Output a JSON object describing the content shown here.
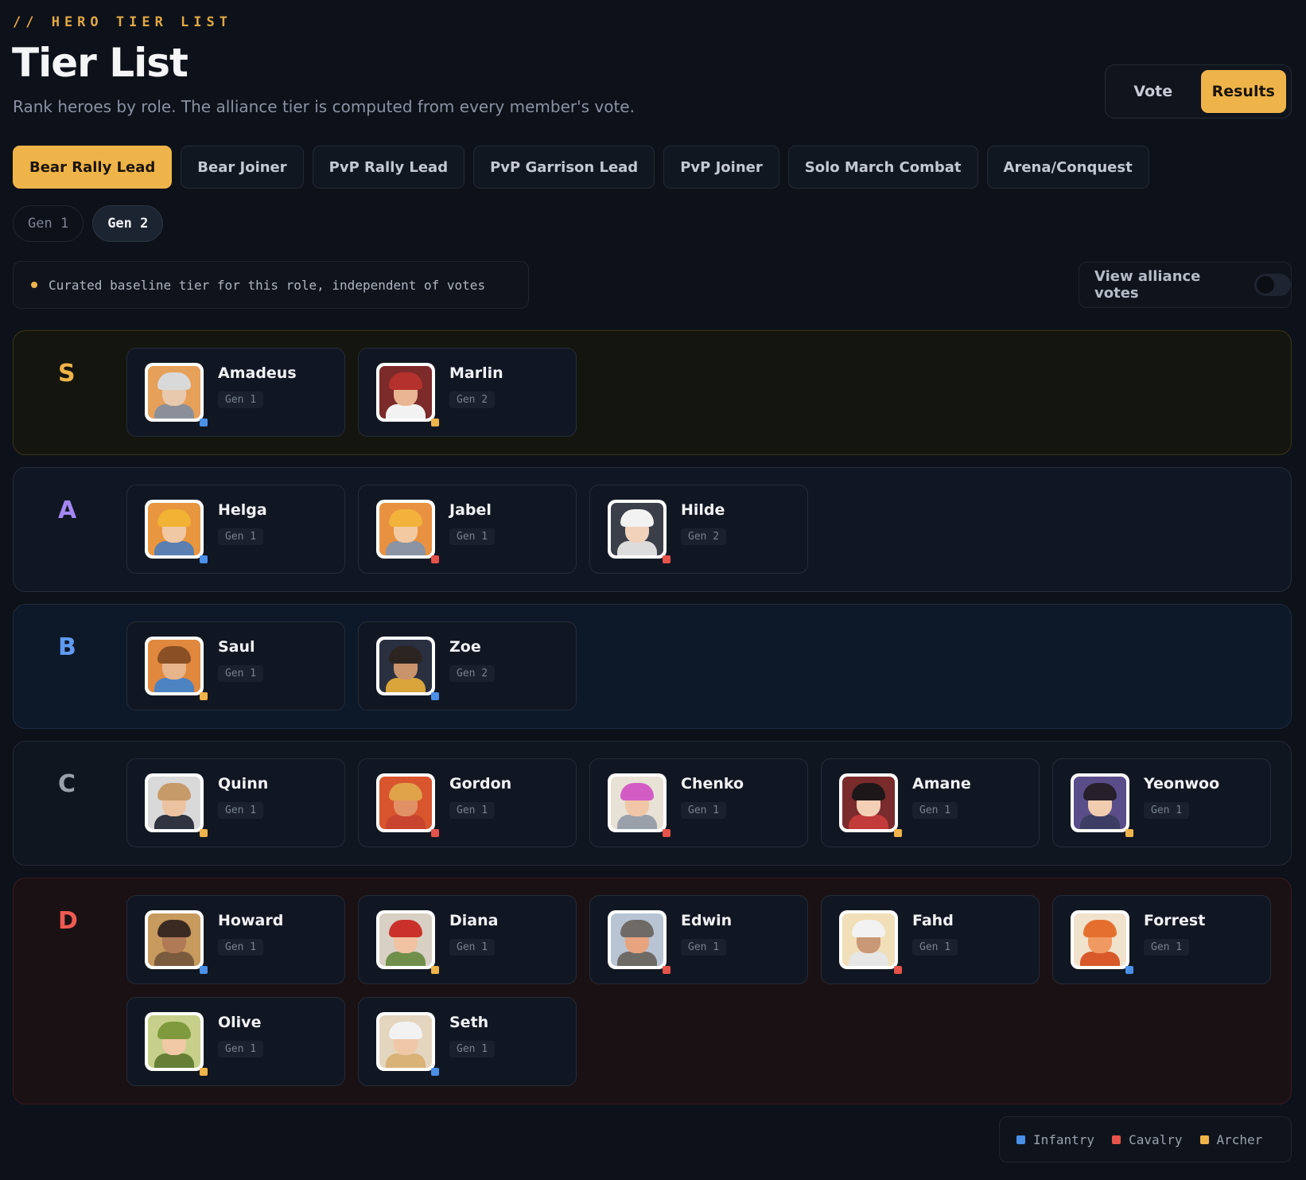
{
  "header": {
    "eyebrow": "// HERO TIER LIST",
    "title": "Tier List",
    "subtitle": "Rank heroes by role. The alliance tier is computed from every member's vote."
  },
  "mode": {
    "vote_label": "Vote",
    "results_label": "Results",
    "active": "Results"
  },
  "roles": {
    "active": "Bear Rally Lead",
    "items": [
      "Bear Rally Lead",
      "Bear Joiner",
      "PvP Rally Lead",
      "PvP Garrison Lead",
      "PvP Joiner",
      "Solo March Combat",
      "Arena/Conquest"
    ]
  },
  "generations": {
    "active": "Gen 2",
    "items": [
      "Gen 1",
      "Gen 2"
    ]
  },
  "note": "Curated baseline tier for this role, independent of votes",
  "alliance_votes": {
    "label": "View alliance votes",
    "enabled": false
  },
  "class_colors": {
    "Infantry": "#4a8fe8",
    "Cavalry": "#e5534b",
    "Archer": "#efb449"
  },
  "tiers": [
    {
      "letter": "S",
      "heroes": [
        {
          "name": "Amadeus",
          "gen": "Gen 1",
          "class": "Infantry",
          "skin": "#e9c9ad",
          "hair": "#d9d9d9",
          "body": "#8b8f99",
          "bg": "#e6a05a"
        },
        {
          "name": "Marlin",
          "gen": "Gen 2",
          "class": "Archer",
          "skin": "#e9b592",
          "hair": "#b5312d",
          "body": "#f2f2f2",
          "bg": "#7c2a2a"
        }
      ]
    },
    {
      "letter": "A",
      "heroes": [
        {
          "name": "Helga",
          "gen": "Gen 1",
          "class": "Infantry",
          "skin": "#f1c8a4",
          "hair": "#f2b233",
          "body": "#5a7fb0",
          "bg": "#e8963f"
        },
        {
          "name": "Jabel",
          "gen": "Gen 1",
          "class": "Cavalry",
          "skin": "#f2c9a1",
          "hair": "#f3b23b",
          "body": "#8a94a4",
          "bg": "#e89140"
        },
        {
          "name": "Hilde",
          "gen": "Gen 2",
          "class": "Cavalry",
          "skin": "#f1d2bb",
          "hair": "#f2f2f2",
          "body": "#dcdcdc",
          "bg": "#3b3f4a"
        }
      ]
    },
    {
      "letter": "B",
      "heroes": [
        {
          "name": "Saul",
          "gen": "Gen 1",
          "class": "Archer",
          "skin": "#e8b48b",
          "hair": "#8a4f24",
          "body": "#4d83c2",
          "bg": "#e0883e"
        },
        {
          "name": "Zoe",
          "gen": "Gen 2",
          "class": "Infantry",
          "skin": "#c9936c",
          "hair": "#2c2420",
          "body": "#d9a43a",
          "bg": "#2a3040"
        }
      ]
    },
    {
      "letter": "C",
      "heroes": [
        {
          "name": "Quinn",
          "gen": "Gen 1",
          "class": "Archer",
          "skin": "#ecc3a0",
          "hair": "#c79a6a",
          "body": "#2f3440",
          "bg": "#d9d9d9"
        },
        {
          "name": "Gordon",
          "gen": "Gen 1",
          "class": "Cavalry",
          "skin": "#e29065",
          "hair": "#e0a34a",
          "body": "#c8442e",
          "bg": "#d8552e"
        },
        {
          "name": "Chenko",
          "gen": "Gen 1",
          "class": "Cavalry",
          "skin": "#f0c6a6",
          "hair": "#d35cc4",
          "body": "#9aa0aa",
          "bg": "#e8e1d6"
        },
        {
          "name": "Amane",
          "gen": "Gen 1",
          "class": "Archer",
          "skin": "#f3cfb6",
          "hair": "#1d1719",
          "body": "#c23a3a",
          "bg": "#7a2b2b"
        },
        {
          "name": "Yeonwoo",
          "gen": "Gen 1",
          "class": "Archer",
          "skin": "#f1cdb0",
          "hair": "#25202a",
          "body": "#3c3f63",
          "bg": "#5a4e8a"
        }
      ]
    },
    {
      "letter": "D",
      "heroes": [
        {
          "name": "Howard",
          "gen": "Gen 1",
          "class": "Infantry",
          "skin": "#b07a56",
          "hair": "#3b2a22",
          "body": "#7b5b3e",
          "bg": "#c79a5e"
        },
        {
          "name": "Diana",
          "gen": "Gen 1",
          "class": "Archer",
          "skin": "#f0c2a2",
          "hair": "#c9312a",
          "body": "#6f8f4a",
          "bg": "#d8d0c4"
        },
        {
          "name": "Edwin",
          "gen": "Gen 1",
          "class": "Cavalry",
          "skin": "#e7a47e",
          "hair": "#6e6a66",
          "body": "#6e6a66",
          "bg": "#b8c4d4"
        },
        {
          "name": "Fahd",
          "gen": "Gen 1",
          "class": "Cavalry",
          "skin": "#c99877",
          "hair": "#f2f2f2",
          "body": "#e6e6e6",
          "bg": "#f0dfb8"
        },
        {
          "name": "Forrest",
          "gen": "Gen 1",
          "class": "Infantry",
          "skin": "#f09a62",
          "hair": "#e5702e",
          "body": "#d85a2a",
          "bg": "#f0e2cd"
        },
        {
          "name": "Olive",
          "gen": "Gen 1",
          "class": "Archer",
          "skin": "#f1c9a6",
          "hair": "#7e9a3c",
          "body": "#667f35",
          "bg": "#c7d08a"
        },
        {
          "name": "Seth",
          "gen": "Gen 1",
          "class": "Infantry",
          "skin": "#f0c8a8",
          "hair": "#f2f2f2",
          "body": "#d9b278",
          "bg": "#e4d5bf"
        }
      ]
    }
  ],
  "legend": [
    {
      "label": "Infantry",
      "color": "#4a8fe8"
    },
    {
      "label": "Cavalry",
      "color": "#e5534b"
    },
    {
      "label": "Archer",
      "color": "#efb449"
    }
  ]
}
